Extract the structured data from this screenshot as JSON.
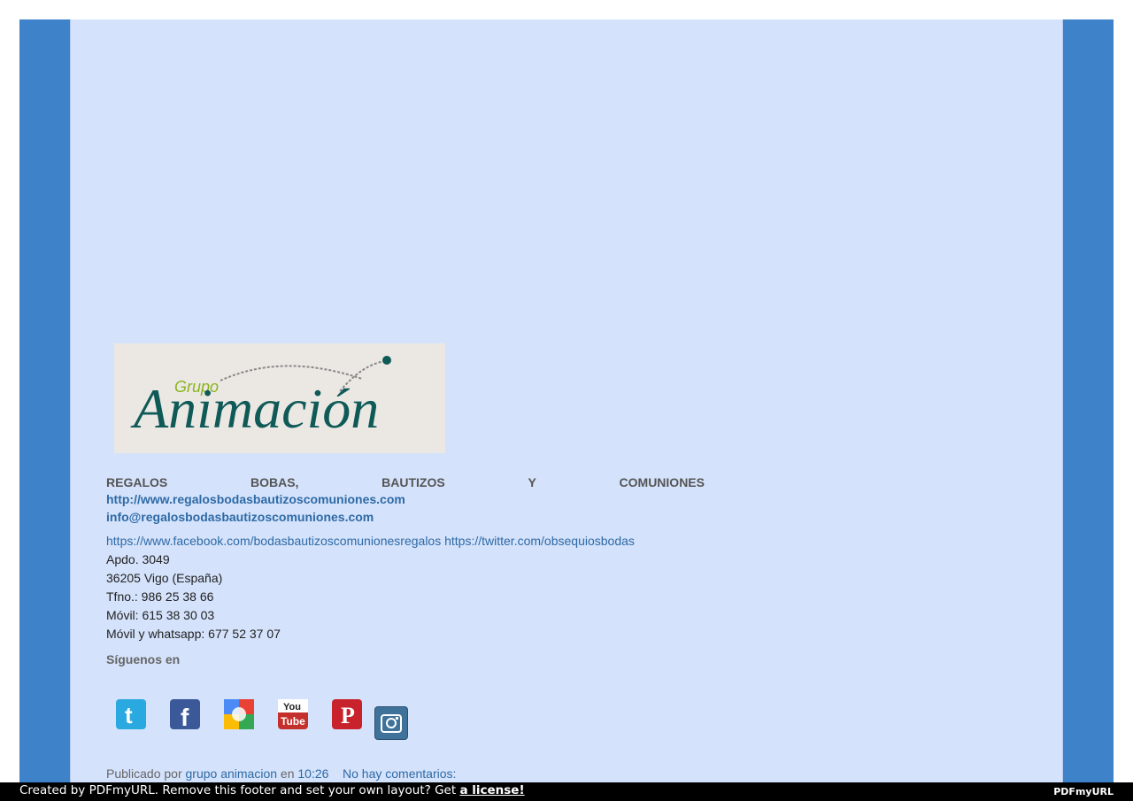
{
  "logo": {
    "small_text": "Grupo",
    "main_text": "Animación",
    "accent_color": "#8ab31e",
    "main_color": "#0f5a57"
  },
  "headline": {
    "words": [
      "REGALOS",
      "BOBAS,",
      "BAUTIZOS",
      "Y",
      "COMUNIONES"
    ]
  },
  "contact": {
    "website": "http://www.regalosbodasbautizoscomuniones.com",
    "email": "info@regalosbodasbautizoscomuniones.com",
    "facebook": "https://www.facebook.com/bodasbautizoscomunionesregalos",
    "twitter": "https://twitter.com/obsequiosbodas",
    "address_line1": "Apdo. 3049",
    "address_line2": "36205 Vigo (España)",
    "phone": "Tfno.: 986 25 38 66",
    "mobile": "Móvil: 615 38 30 03",
    "whatsapp": "Móvil y whatsapp: 677 52 37 07"
  },
  "follow": {
    "title": "Síguenos en"
  },
  "social_icons": [
    {
      "name": "twitter-icon",
      "color": "#29a9df"
    },
    {
      "name": "facebook-icon",
      "color": "#3b5998"
    },
    {
      "name": "google-icon",
      "color": "#4c8bf5"
    },
    {
      "name": "youtube-icon",
      "color": "#c4302b"
    },
    {
      "name": "pinterest-icon",
      "color": "#c8232c"
    },
    {
      "name": "instagram-icon",
      "color": "#3f729b"
    }
  ],
  "post_meta": {
    "published_by": "Publicado por",
    "author": "grupo animacion",
    "at": "en",
    "time": "10:26",
    "comments": "No hay comentarios:"
  },
  "footer": {
    "text": "Created by PDFmyURL. Remove this footer and set your own layout? Get",
    "license_link": "a license!",
    "brand": "PDFmyURL"
  }
}
